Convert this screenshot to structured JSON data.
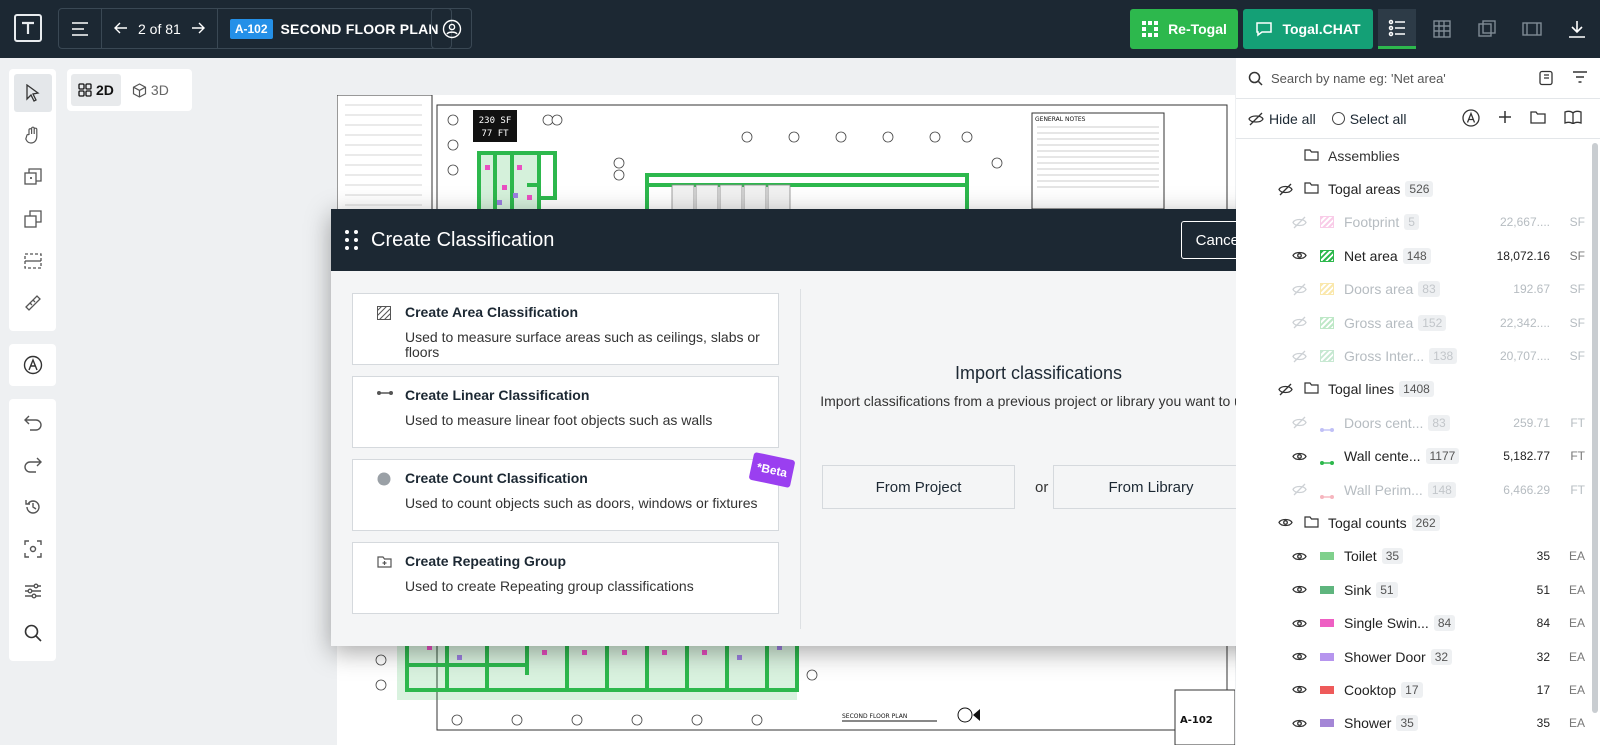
{
  "topbar": {
    "pager": "2 of 81",
    "sheet_id": "A-102",
    "sheet_name": "SECOND FLOOR PLAN",
    "retogal_label": "Re-Togal",
    "chat_label": "Togal.CHAT",
    "retogal_color": "#2db84d",
    "chat_color": "#14a076"
  },
  "view": {
    "label_2d": "2D",
    "label_3d": "3D"
  },
  "drawing": {
    "tag_area": "230 SF",
    "tag_len": "77 FT",
    "notes_title": "GENERAL NOTES",
    "sheet_number": "A-102",
    "plan_title": "SECOND FLOOR PLAN"
  },
  "modal": {
    "title": "Create Classification",
    "cancel": "Cancel",
    "options": [
      {
        "title": "Create Area Classification",
        "desc": "Used to measure surface areas such as ceilings, slabs or floors"
      },
      {
        "title": "Create Linear Classification",
        "desc": "Used to measure linear foot objects such as walls"
      },
      {
        "title": "Create Count Classification",
        "desc": "Used to count objects such as doors, windows or fixtures"
      },
      {
        "title": "Create Repeating Group",
        "desc": "Used to create Repeating group classifications"
      }
    ],
    "beta": "*Beta",
    "import_title": "Import classifications",
    "import_desc": "Import classifications from a previous project or library you want to use",
    "from_project": "From Project",
    "or": "or",
    "from_library": "From Library"
  },
  "panel": {
    "search_placeholder": "Search by name eg: 'Net area'",
    "hide_all": "Hide all",
    "select_all": "Select all",
    "assemblies": "Assemblies",
    "groups": [
      {
        "name": "Togal areas",
        "count": "526",
        "items": [
          {
            "name": "Footprint",
            "count": "5",
            "value": "22,667....",
            "unit": "SF",
            "color": "#f5a3d6",
            "visible": false
          },
          {
            "name": "Net area",
            "count": "148",
            "value": "18,072.16",
            "unit": "SF",
            "color": "#2db84d",
            "visible": true
          },
          {
            "name": "Doors area",
            "count": "83",
            "value": "192.67",
            "unit": "SF",
            "color": "#f7d66b",
            "visible": false
          },
          {
            "name": "Gross area",
            "count": "152",
            "value": "22,342....",
            "unit": "SF",
            "color": "#8ad69a",
            "visible": false
          },
          {
            "name": "Gross Inter...",
            "count": "138",
            "value": "20,707....",
            "unit": "SF",
            "color": "#9ad6ae",
            "visible": false
          }
        ]
      },
      {
        "name": "Togal lines",
        "count": "1408",
        "items": [
          {
            "name": "Doors cent...",
            "count": "83",
            "value": "259.71",
            "unit": "FT",
            "color": "#8e8ef0",
            "visible": false
          },
          {
            "name": "Wall cente...",
            "count": "1177",
            "value": "5,182.77",
            "unit": "FT",
            "color": "#2db84d",
            "visible": true
          },
          {
            "name": "Wall Perim...",
            "count": "148",
            "value": "6,466.29",
            "unit": "FT",
            "color": "#f07a8a",
            "visible": false
          }
        ]
      },
      {
        "name": "Togal counts",
        "count": "262",
        "items": [
          {
            "name": "Toilet",
            "count": "35",
            "value": "35",
            "unit": "EA",
            "color": "#7fd08c",
            "visible": true
          },
          {
            "name": "Sink",
            "count": "51",
            "value": "51",
            "unit": "EA",
            "color": "#5fb57e",
            "visible": true
          },
          {
            "name": "Single Swin...",
            "count": "84",
            "value": "84",
            "unit": "EA",
            "color": "#ee5fc3",
            "visible": true
          },
          {
            "name": "Shower Door",
            "count": "32",
            "value": "32",
            "unit": "EA",
            "color": "#b695ee",
            "visible": true
          },
          {
            "name": "Cooktop",
            "count": "17",
            "value": "17",
            "unit": "EA",
            "color": "#ee5a5a",
            "visible": true
          },
          {
            "name": "Shower",
            "count": "35",
            "value": "35",
            "unit": "EA",
            "color": "#a486d6",
            "visible": true
          }
        ]
      }
    ]
  }
}
